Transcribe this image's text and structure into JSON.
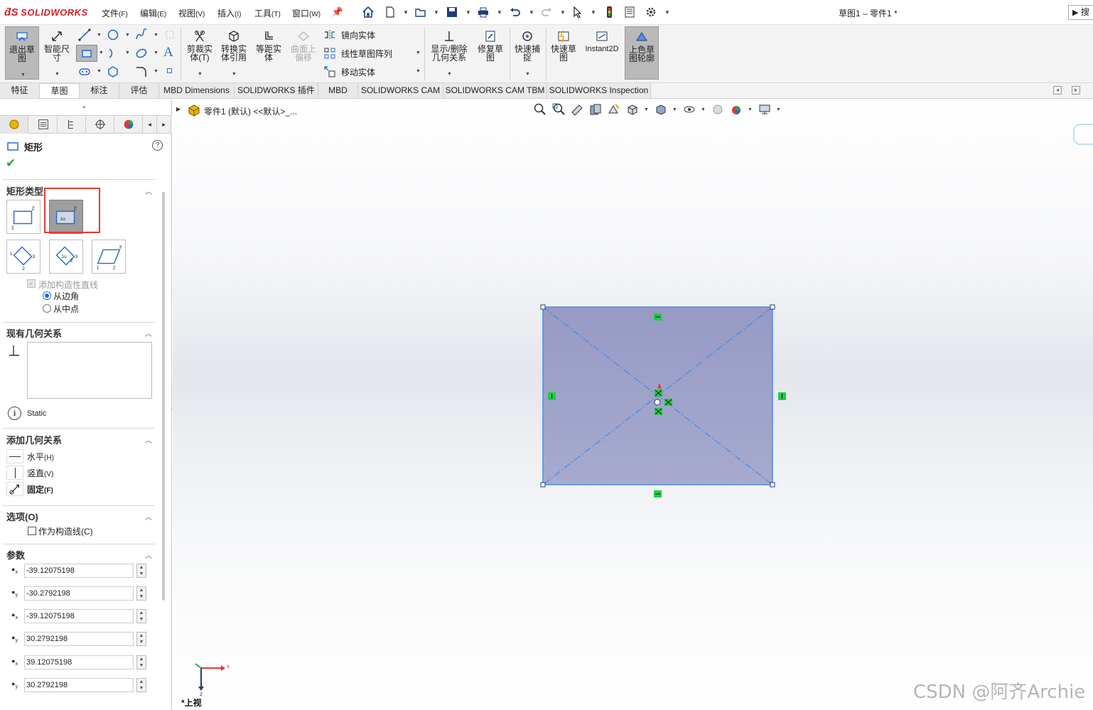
{
  "app": {
    "logo_text": "SOLIDWORKS",
    "document_title": "草图1 – 零件1 *",
    "search_text": "搜"
  },
  "menus": [
    {
      "label": "文件",
      "key": "(F)"
    },
    {
      "label": "编辑",
      "key": "(E)"
    },
    {
      "label": "视图",
      "key": "(V)"
    },
    {
      "label": "插入",
      "key": "(I)"
    },
    {
      "label": "工具",
      "key": "(T)"
    },
    {
      "label": "窗口",
      "key": "(W)"
    }
  ],
  "command_manager": {
    "exit_sketch": "退出草图",
    "smart_dimension": "智能尺寸",
    "trim_entities": "剪裁实体(T)",
    "convert_entities": "转换实体引用",
    "offset_entities": "等距实体",
    "offset_on_surface": "曲面上偏移",
    "mirror_entities": "镜向实体",
    "linear_pattern": "线性草图阵列",
    "move_entities": "移动实体",
    "display_relations": "显示/删除几何关系",
    "repair_sketch": "修复草图",
    "quick_snaps": "快速捕捉",
    "rapid_sketch": "快速草图",
    "instant2d": "Instant2D",
    "shaded_contours": "上色草图轮廓"
  },
  "tabs": [
    "特征",
    "草图",
    "标注",
    "评估",
    "MBD Dimensions",
    "SOLIDWORKS 插件",
    "MBD",
    "SOLIDWORKS CAM",
    "SOLIDWORKS CAM TBM",
    "SOLIDWORKS Inspection"
  ],
  "active_tab": "草图",
  "property_manager": {
    "title": "矩形",
    "sections": {
      "rect_type": "矩形类型",
      "existing_relations": "现有几何关系",
      "add_relations": "添加几何关系",
      "options": "选项(O)",
      "parameters": "参数"
    },
    "add_construction_lines": "添加构造性直线",
    "from_corners": "从边角",
    "from_midpoints": "从中点",
    "status": "Static",
    "relations": [
      {
        "label": "水平",
        "key": "(H)"
      },
      {
        "label": "竖直",
        "key": "(V)"
      },
      {
        "label": "固定",
        "key": "(F)"
      }
    ],
    "as_construction": "作为构造线(C)",
    "params": [
      {
        "axis": "x",
        "value": "-39.12075198"
      },
      {
        "axis": "y",
        "value": "-30.2792198"
      },
      {
        "axis": "x",
        "value": "-39.12075198"
      },
      {
        "axis": "y",
        "value": "30.2792198"
      },
      {
        "axis": "x",
        "value": "39.12075198"
      },
      {
        "axis": "y",
        "value": "30.2792198"
      }
    ]
  },
  "graphics": {
    "breadcrumb": "零件1 (默认) <<默认>_...",
    "view_name": "*上视",
    "triad_x": "x",
    "triad_z": "z",
    "watermark": "CSDN @阿齐Archie"
  },
  "colors": {
    "rect_fill": "#9a9ec4",
    "rect_stroke": "#4a8ee8",
    "relation_green": "#22cc44",
    "highlight_red": "#e53935"
  }
}
